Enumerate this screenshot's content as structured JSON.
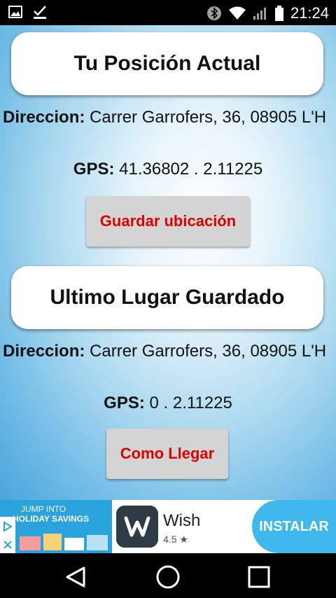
{
  "status_bar": {
    "time": "21:24",
    "icons": [
      "image-icon",
      "check-download-icon",
      "bluetooth-icon",
      "wifi-icon",
      "signal-icon",
      "battery-icon"
    ]
  },
  "current_position": {
    "title": "Tu Posición Actual",
    "address_label": "Direccion:",
    "address_value": "Carrer Garrofers, 36, 08905 L'H",
    "gps_label": "GPS:",
    "gps_value": "41.36802 . 2.11225",
    "save_button": "Guardar ubicación"
  },
  "last_saved": {
    "title": "Ultimo Lugar Guardado",
    "address_label": "Direccion:",
    "address_value": "Carrer Garrofers, 36, 08905 L'H",
    "gps_label": "GPS:",
    "gps_value": "0 . 2.11225",
    "directions_button": "Como Llegar"
  },
  "ad": {
    "banner_line1": "JUMP INTO",
    "banner_line2": "HOLIDAY SAVINGS",
    "app_name": "Wish",
    "rating": "4.5",
    "install_button": "INSTALAR",
    "colors": {
      "banner": "#2aa3dc",
      "install": "#3fb8ec"
    }
  },
  "nav_bar": {
    "icons": [
      "back-icon",
      "home-icon",
      "recents-icon"
    ]
  },
  "colors": {
    "button_text": "#e00000",
    "button_bg": "#d4d4d4"
  }
}
